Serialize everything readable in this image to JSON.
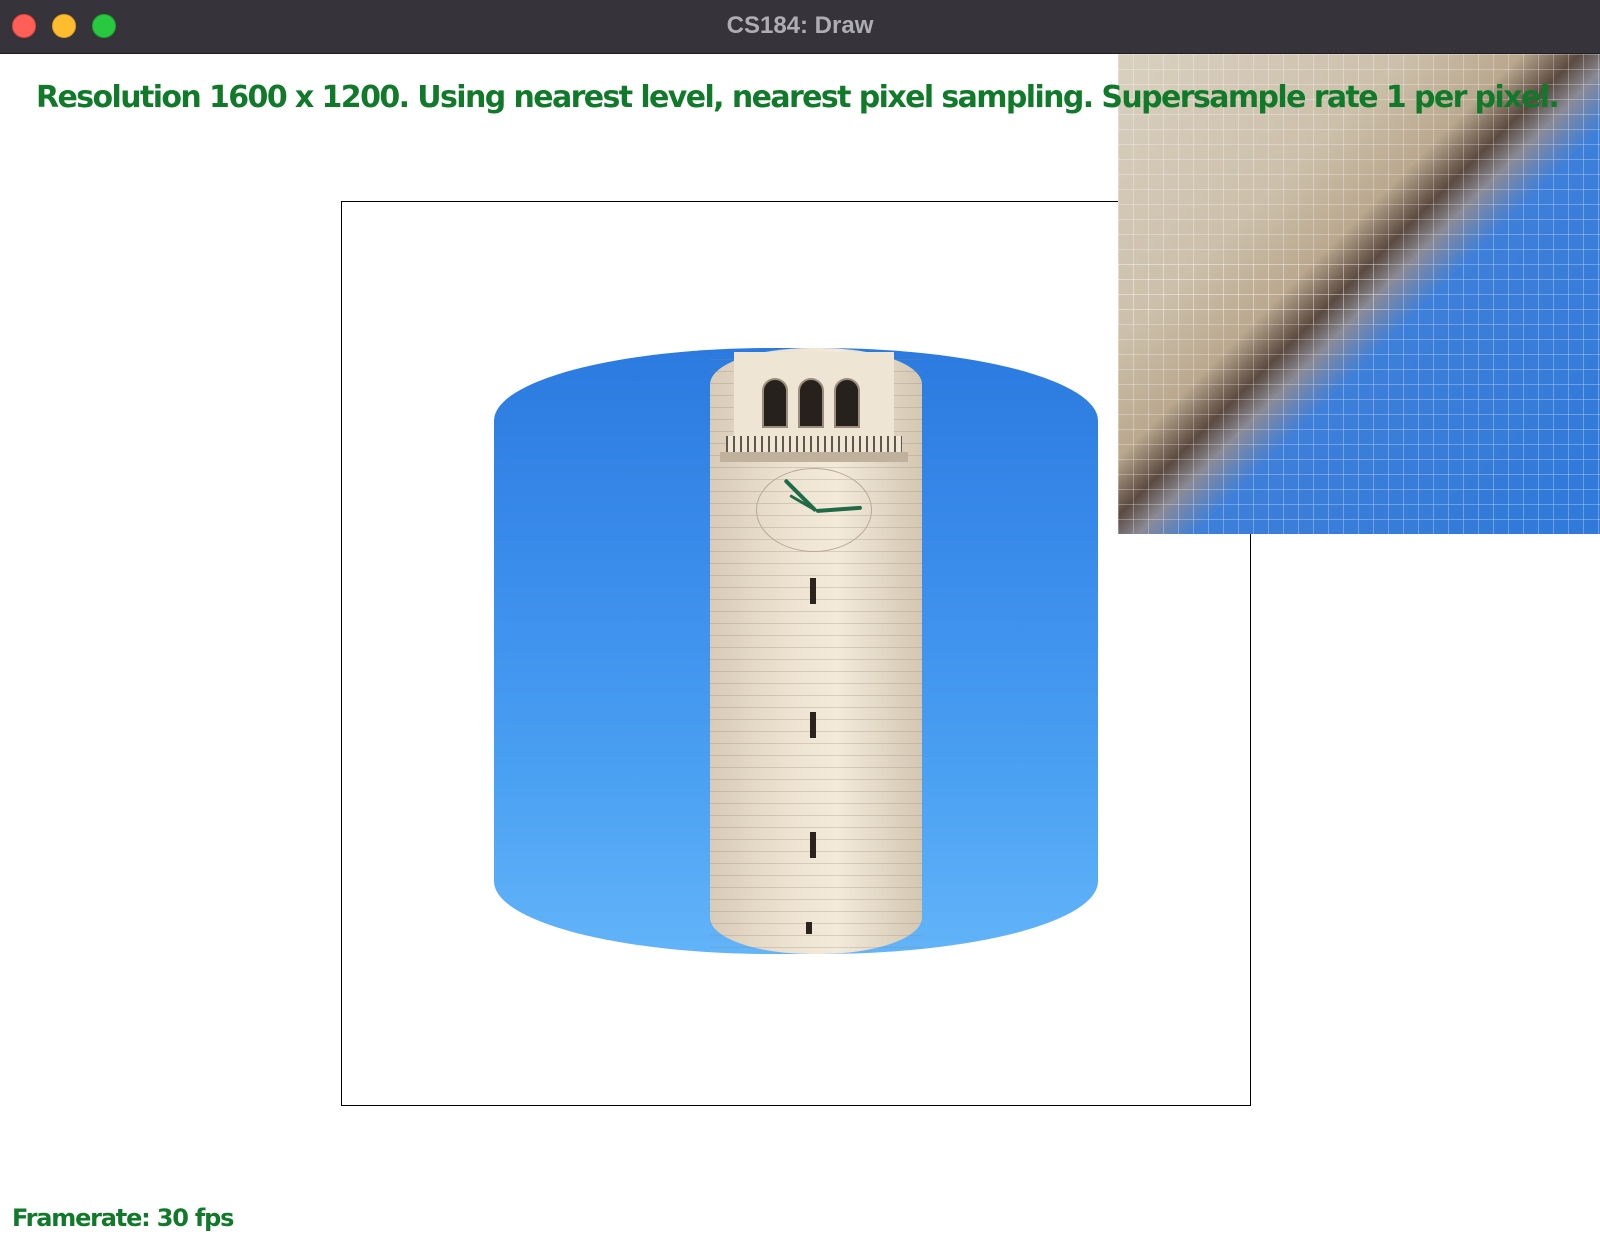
{
  "window": {
    "title": "CS184: Draw",
    "buttons": [
      "close",
      "minimize",
      "maximize"
    ]
  },
  "status": {
    "line": "Resolution 1600 x 1200. Using nearest level, nearest pixel sampling. Supersample rate 1 per pixel.",
    "framerate": "Framerate: 30 fps"
  },
  "colors": {
    "status_text": "#107a2a",
    "titlebar": "#36343a",
    "close": "#ff5f57",
    "minimize": "#febc2e",
    "maximize": "#28c840"
  }
}
